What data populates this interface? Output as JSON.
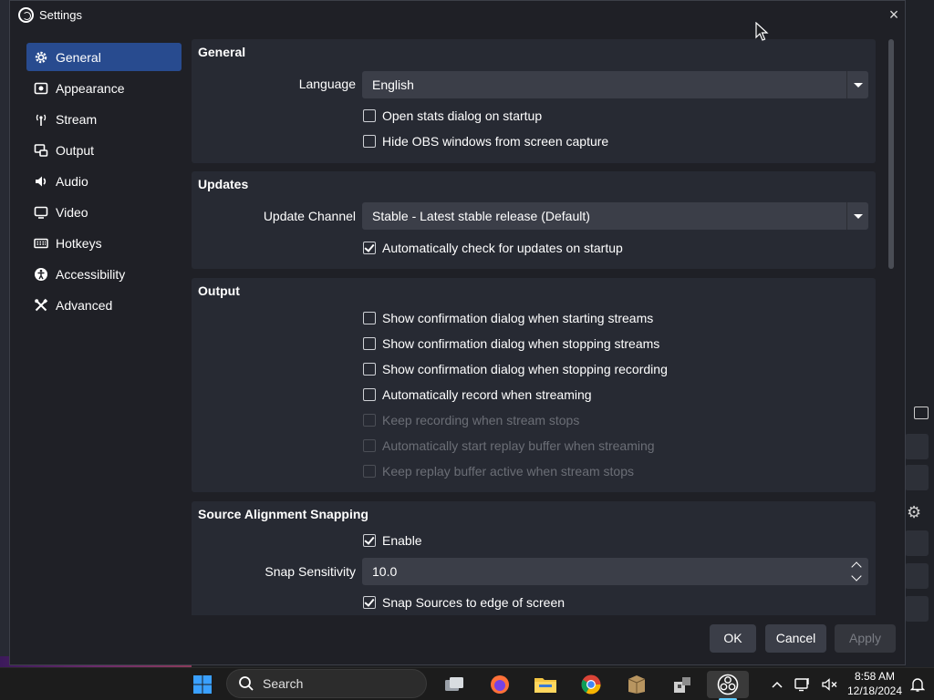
{
  "window": {
    "title": "Settings",
    "close_label": "×"
  },
  "sidebar": {
    "items": [
      {
        "label": "General",
        "icon": "gear-icon",
        "active": true
      },
      {
        "label": "Appearance",
        "icon": "appearance-icon"
      },
      {
        "label": "Stream",
        "icon": "broadcast-icon"
      },
      {
        "label": "Output",
        "icon": "output-icon"
      },
      {
        "label": "Audio",
        "icon": "speaker-icon"
      },
      {
        "label": "Video",
        "icon": "monitor-icon"
      },
      {
        "label": "Hotkeys",
        "icon": "keyboard-icon"
      },
      {
        "label": "Accessibility",
        "icon": "accessibility-icon"
      },
      {
        "label": "Advanced",
        "icon": "tools-icon"
      }
    ]
  },
  "general": {
    "title": "General",
    "language_label": "Language",
    "language_value": "English",
    "open_stats": {
      "label": "Open stats dialog on startup",
      "checked": false
    },
    "hide_obs": {
      "label": "Hide OBS windows from screen capture",
      "checked": false
    }
  },
  "updates": {
    "title": "Updates",
    "channel_label": "Update Channel",
    "channel_value": "Stable - Latest stable release (Default)",
    "auto_check": {
      "label": "Automatically check for updates on startup",
      "checked": true
    }
  },
  "output": {
    "title": "Output",
    "items": [
      {
        "label": "Show confirmation dialog when starting streams",
        "checked": false,
        "enabled": true
      },
      {
        "label": "Show confirmation dialog when stopping streams",
        "checked": false,
        "enabled": true
      },
      {
        "label": "Show confirmation dialog when stopping recording",
        "checked": false,
        "enabled": true
      },
      {
        "label": "Automatically record when streaming",
        "checked": false,
        "enabled": true
      },
      {
        "label": "Keep recording when stream stops",
        "checked": false,
        "enabled": false
      },
      {
        "label": "Automatically start replay buffer when streaming",
        "checked": false,
        "enabled": false
      },
      {
        "label": "Keep replay buffer active when stream stops",
        "checked": false,
        "enabled": false
      }
    ]
  },
  "snapping": {
    "title": "Source Alignment Snapping",
    "enable": {
      "label": "Enable",
      "checked": true
    },
    "sensitivity_label": "Snap Sensitivity",
    "sensitivity_value": "10.0",
    "snap_edge": {
      "label": "Snap Sources to edge of screen",
      "checked": true
    }
  },
  "buttons": {
    "ok": "OK",
    "cancel": "Cancel",
    "apply": "Apply"
  },
  "taskbar": {
    "search_placeholder": "Search",
    "time": "8:58 AM",
    "date": "12/18/2024"
  },
  "colors": {
    "accent": "#284b8f",
    "panel": "#272a33",
    "bg": "#1f2026",
    "input": "#3b3e48"
  }
}
